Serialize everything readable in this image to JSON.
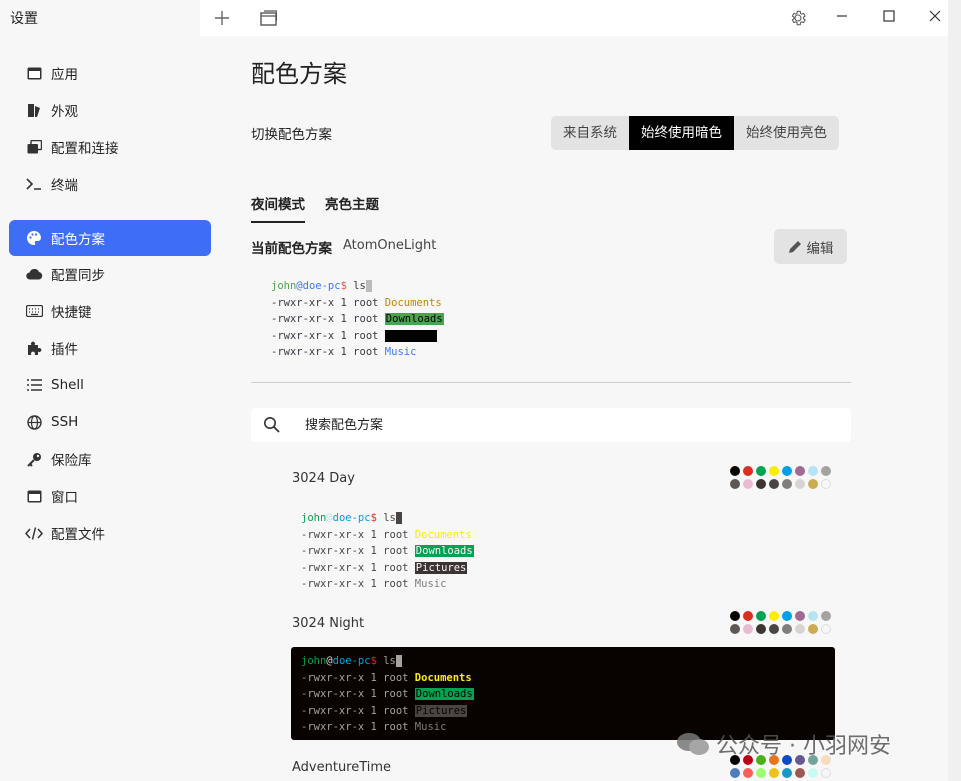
{
  "window": {
    "title": "设置",
    "controls": {
      "minimize": "—",
      "maximize": "☐",
      "close": "✕"
    }
  },
  "sidebar": {
    "items": [
      {
        "label": "应用",
        "icon": "app-window-icon"
      },
      {
        "label": "外观",
        "icon": "paint-brush-icon"
      },
      {
        "label": "配置和连接",
        "icon": "window-stack-icon"
      },
      {
        "label": "终端",
        "icon": "terminal-prompt-icon"
      },
      {
        "label": "配色方案",
        "icon": "palette-icon",
        "active": true
      },
      {
        "label": "配置同步",
        "icon": "cloud-icon"
      },
      {
        "label": "快捷键",
        "icon": "keyboard-icon"
      },
      {
        "label": "插件",
        "icon": "puzzle-icon"
      },
      {
        "label": "Shell",
        "icon": "list-icon"
      },
      {
        "label": "SSH",
        "icon": "globe-icon"
      },
      {
        "label": "保险库",
        "icon": "key-icon"
      },
      {
        "label": "窗口",
        "icon": "window-icon"
      },
      {
        "label": "配置文件",
        "icon": "code-icon"
      }
    ]
  },
  "main": {
    "title": "配色方案",
    "switch_label": "切换配色方案",
    "switch_options": [
      "来自系统",
      "始终使用暗色",
      "始终使用亮色"
    ],
    "switch_selected": "始终使用暗色",
    "subtabs": [
      "夜间模式",
      "亮色主题"
    ],
    "current_label": "当前配色方案",
    "current_scheme": "AtomOneLight",
    "edit_label": "编辑",
    "search_placeholder": "搜索配色方案",
    "preview_lines": {
      "prompt_user": "john",
      "prompt_at": "@",
      "prompt_host": "doe-pc",
      "prompt_sign": "$",
      "command": "ls",
      "prefix": "-rwxr-xr-x 1 root ",
      "files": [
        "Documents",
        "Downloads",
        "Pictures",
        "Music"
      ]
    },
    "schemes": [
      {
        "name": "3024 Day",
        "colors": [
          "#090300",
          "#db2d20",
          "#01a252",
          "#fded02",
          "#01a0e4",
          "#a16a94",
          "#b5e4f4",
          "#a5a2a2",
          "#5c5855",
          "#e8bbd0",
          "#3a3432",
          "#4a4543",
          "#807d7c",
          "#d6d5d4",
          "#cdab53",
          "#f7f7f7"
        ]
      },
      {
        "name": "3024 Night",
        "colors": [
          "#090300",
          "#db2d20",
          "#01a252",
          "#fded02",
          "#01a0e4",
          "#a16a94",
          "#b5e4f4",
          "#a5a2a2",
          "#5c5855",
          "#e8bbd0",
          "#3a3432",
          "#4a4543",
          "#807d7c",
          "#d6d5d4",
          "#cdab53",
          "#f7f7f7"
        ]
      },
      {
        "name": "AdventureTime",
        "colors": [
          "#050404",
          "#bd0013",
          "#4ab118",
          "#e7741e",
          "#0f4ac6",
          "#665993",
          "#70a598",
          "#f8dcc0",
          "#4e7cbf",
          "#fc5f5a",
          "#9eff6e",
          "#efc11a",
          "#1997c6",
          "#9b5953",
          "#c8faf4",
          "#f6f5fb"
        ]
      }
    ]
  },
  "watermark": "公众号 · 小羽网安"
}
